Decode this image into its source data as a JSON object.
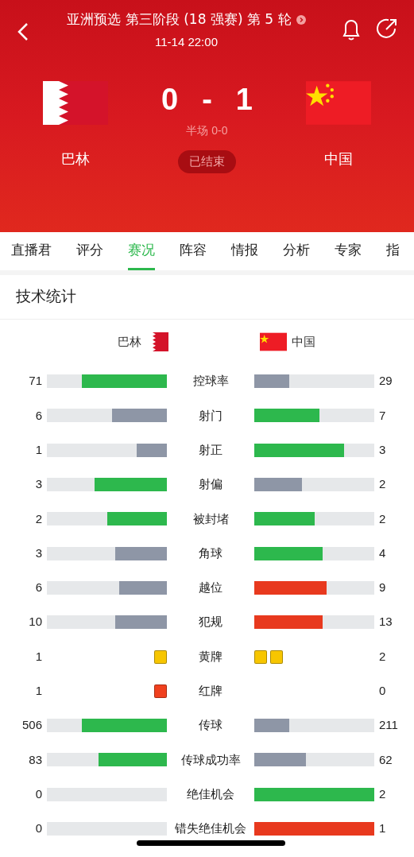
{
  "header": {
    "title": "亚洲预选 第三阶段 (18 强赛) 第 5 轮",
    "time": "11-14 22:00",
    "home": {
      "name": "巴林",
      "score": "0"
    },
    "separator": "-",
    "away": {
      "name": "中国",
      "score": "1"
    },
    "halftime": "半场 0-0",
    "status": "已结束"
  },
  "tabs": [
    {
      "label": "直播君",
      "selected": false
    },
    {
      "label": "评分",
      "selected": false
    },
    {
      "label": "赛况",
      "selected": true
    },
    {
      "label": "阵容",
      "selected": false
    },
    {
      "label": "情报",
      "selected": false
    },
    {
      "label": "分析",
      "selected": false
    },
    {
      "label": "专家",
      "selected": false
    },
    {
      "label": "指",
      "selected": false
    }
  ],
  "section_title": "技术统计",
  "legend": {
    "home": "巴林",
    "away": "中国"
  },
  "stats": [
    {
      "kind": "bar",
      "label": "控球率",
      "home": {
        "value": "71",
        "level": 0.71,
        "color": "#2db84d"
      },
      "away": {
        "value": "29",
        "level": 0.29,
        "color": "#8e96a6"
      }
    },
    {
      "kind": "bar",
      "label": "射门",
      "home": {
        "value": "6",
        "level": 0.46,
        "color": "#8e96a6"
      },
      "away": {
        "value": "7",
        "level": 0.54,
        "color": "#2db84d"
      }
    },
    {
      "kind": "bar",
      "label": "射正",
      "home": {
        "value": "1",
        "level": 0.25,
        "color": "#8e96a6"
      },
      "away": {
        "value": "3",
        "level": 0.75,
        "color": "#2db84d"
      }
    },
    {
      "kind": "bar",
      "label": "射偏",
      "home": {
        "value": "3",
        "level": 0.6,
        "color": "#2db84d"
      },
      "away": {
        "value": "2",
        "level": 0.4,
        "color": "#8e96a6"
      }
    },
    {
      "kind": "bar",
      "label": "被封堵",
      "home": {
        "value": "2",
        "level": 0.5,
        "color": "#2db84d"
      },
      "away": {
        "value": "2",
        "level": 0.5,
        "color": "#2db84d"
      }
    },
    {
      "kind": "bar",
      "label": "角球",
      "home": {
        "value": "3",
        "level": 0.43,
        "color": "#8e96a6"
      },
      "away": {
        "value": "4",
        "level": 0.57,
        "color": "#2db84d"
      }
    },
    {
      "kind": "bar",
      "label": "越位",
      "home": {
        "value": "6",
        "level": 0.4,
        "color": "#8e96a6"
      },
      "away": {
        "value": "9",
        "level": 0.6,
        "color": "#e8391e"
      }
    },
    {
      "kind": "bar",
      "label": "犯规",
      "home": {
        "value": "10",
        "level": 0.43,
        "color": "#8e96a6"
      },
      "away": {
        "value": "13",
        "level": 0.57,
        "color": "#e8391e"
      }
    },
    {
      "kind": "cards",
      "label": "黄牌",
      "home": {
        "value": "1",
        "color": "#f7c600"
      },
      "away": {
        "value": "2",
        "color": "#f7c600"
      }
    },
    {
      "kind": "cards",
      "label": "红牌",
      "home": {
        "value": "1",
        "color": "#f0401e"
      },
      "away": {
        "value": "0"
      }
    },
    {
      "kind": "bar",
      "label": "传球",
      "home": {
        "value": "506",
        "level": 0.71,
        "color": "#2db84d"
      },
      "away": {
        "value": "211",
        "level": 0.29,
        "color": "#8e96a6"
      }
    },
    {
      "kind": "bar",
      "label": "传球成功率",
      "home": {
        "value": "83",
        "level": 0.57,
        "color": "#2db84d"
      },
      "away": {
        "value": "62",
        "level": 0.43,
        "color": "#8e96a6"
      }
    },
    {
      "kind": "bar",
      "label": "绝佳机会",
      "home": {
        "value": "0"
      },
      "away": {
        "value": "2",
        "level": 1,
        "color": "#2db84d"
      }
    },
    {
      "kind": "bar",
      "label": "错失绝佳机会",
      "home": {
        "value": "0"
      },
      "away": {
        "value": "1",
        "level": 1,
        "color": "#e8391e"
      }
    }
  ]
}
